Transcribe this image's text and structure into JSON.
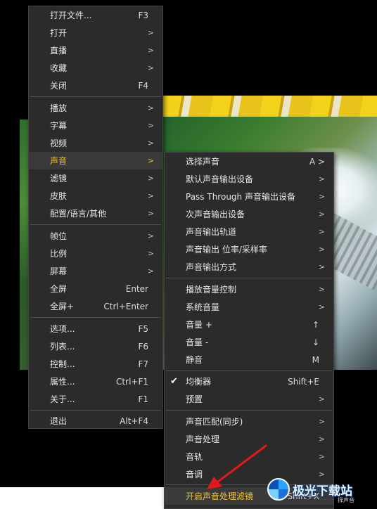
{
  "main_menu": {
    "items": [
      {
        "label": "打开文件...",
        "shortcut": "F3"
      },
      {
        "label": "打开",
        "arrow": ">"
      },
      {
        "label": "直播",
        "arrow": ">"
      },
      {
        "label": "收藏",
        "arrow": ">"
      },
      {
        "label": "关闭",
        "shortcut": "F4"
      },
      {
        "label": "播放",
        "arrow": ">"
      },
      {
        "label": "字幕",
        "arrow": ">"
      },
      {
        "label": "视频",
        "arrow": ">"
      },
      {
        "label": "声音",
        "arrow": ">"
      },
      {
        "label": "滤镜",
        "arrow": ">"
      },
      {
        "label": "皮肤",
        "arrow": ">"
      },
      {
        "label": "配置/语言/其他",
        "arrow": ">"
      },
      {
        "label": "帧位",
        "arrow": ">"
      },
      {
        "label": "比例",
        "arrow": ">"
      },
      {
        "label": "屏幕",
        "arrow": ">"
      },
      {
        "label": "全屏",
        "shortcut": "Enter"
      },
      {
        "label": "全屏+",
        "shortcut": "Ctrl+Enter"
      },
      {
        "label": "选项...",
        "shortcut": "F5"
      },
      {
        "label": "列表...",
        "shortcut": "F6"
      },
      {
        "label": "控制...",
        "shortcut": "F7"
      },
      {
        "label": "属性...",
        "shortcut": "Ctrl+F1"
      },
      {
        "label": "关于...",
        "shortcut": "F1"
      },
      {
        "label": "退出",
        "shortcut": "Alt+F4"
      }
    ]
  },
  "sound_menu": {
    "items": [
      {
        "label": "选择声音",
        "shortcut": "A >"
      },
      {
        "label": "默认声音输出设备",
        "arrow": ">"
      },
      {
        "label": "Pass Through 声音输出设备",
        "arrow": ">"
      },
      {
        "label": "次声音输出设备",
        "arrow": ">"
      },
      {
        "label": "声音输出轨道",
        "arrow": ">"
      },
      {
        "label": "声音输出 位率/采样率",
        "arrow": ">"
      },
      {
        "label": "声音输出方式",
        "arrow": ">"
      },
      {
        "label": "播放音量控制",
        "arrow": ">"
      },
      {
        "label": "系统音量",
        "arrow": ">"
      },
      {
        "label": "音量 +",
        "shortcut": "↑"
      },
      {
        "label": "音量 -",
        "shortcut": "↓"
      },
      {
        "label": "静音",
        "shortcut": "M"
      },
      {
        "label": "均衡器",
        "shortcut": "Shift+E",
        "checked": true
      },
      {
        "label": "预置",
        "arrow": ">"
      },
      {
        "label": "声音匹配(同步)",
        "arrow": ">"
      },
      {
        "label": "声音处理",
        "arrow": ">"
      },
      {
        "label": "音轨",
        "arrow": ">"
      },
      {
        "label": "音调",
        "arrow": ">"
      },
      {
        "label": "开启声音处理滤镜",
        "shortcut": "Shift+X"
      }
    ]
  },
  "watermark": {
    "text": "极光下载站",
    "sub": "择声音"
  },
  "colors": {
    "highlight": "#f2c037",
    "menu_bg": "#2b2b2b",
    "annotation_arrow": "#e0191b"
  }
}
